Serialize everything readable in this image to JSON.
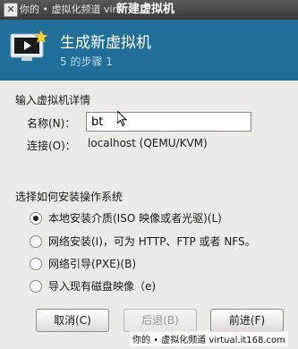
{
  "titlebar": {
    "close_glyph": "✕",
    "wm_text": "你的 • 虚拟化频道  virt",
    "title": "新建虚拟机"
  },
  "header": {
    "icon": "monitor-star-icon",
    "title": "生成新虚拟机",
    "step": "5 的步骤 1"
  },
  "details": {
    "section_title": "输入虚拟机详情",
    "name_label": "名称(N)：",
    "name_value": "bt",
    "connection_label": "连接(O)：",
    "connection_value": "localhost (QEMU/KVM)"
  },
  "install": {
    "section_title": "选择如何安装操作系统",
    "options": [
      {
        "label": "本地安装介质(ISO 映像或者光驱)(L)",
        "selected": true
      },
      {
        "label": "网络安装(I)，可为 HTTP、FTP 或者 NFS。",
        "selected": false
      },
      {
        "label": "网络引导(PXE)(B)",
        "selected": false
      },
      {
        "label": "导入现有磁盘映像（e)",
        "selected": false
      }
    ]
  },
  "buttons": {
    "cancel": "取消(C)",
    "back": "后退(B)",
    "forward": "前进(F)"
  },
  "watermark": "你的 • 虚拟化频道  virtual.it168.com",
  "colors": {
    "header_bg": "#1f6f98",
    "window_bg": "#eceae7"
  }
}
